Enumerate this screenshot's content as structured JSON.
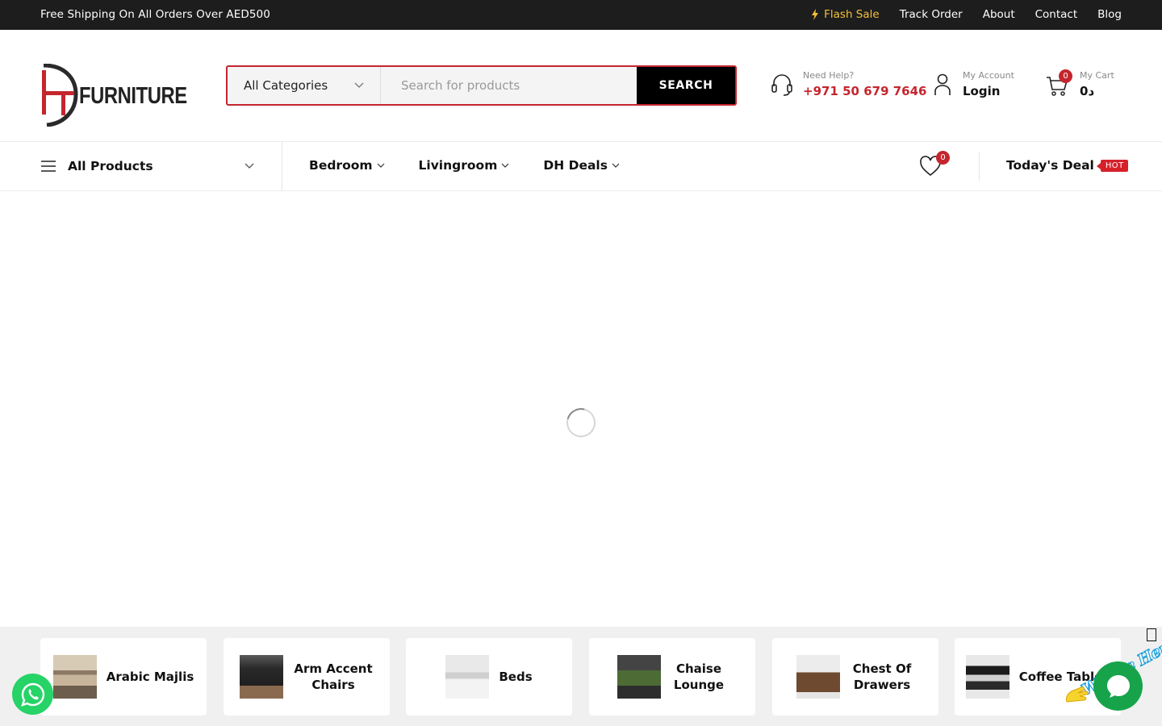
{
  "topbar": {
    "shipping": "Free Shipping On All Orders Over AED500",
    "links": [
      "Flash Sale",
      "Track Order",
      "About",
      "Contact",
      "Blog"
    ]
  },
  "logo": {
    "text": "FURNITURE"
  },
  "search": {
    "category": "All Categories",
    "placeholder": "Search for products",
    "button": "SEARCH"
  },
  "help": {
    "label": "Need Help?",
    "phone": "+971 50 679 7646"
  },
  "account": {
    "label": "My Account",
    "action": "Login"
  },
  "cart": {
    "label": "My Cart",
    "total": "0د",
    "count": "0"
  },
  "nav": {
    "all_products": "All Products",
    "items": [
      "Bedroom",
      "Livingroom",
      "DH Deals"
    ],
    "wishlist_count": "0",
    "deal": "Today's Deal",
    "deal_badge": "HOT"
  },
  "categories": [
    {
      "name": "Arabic Majlis"
    },
    {
      "name": "Arm Accent Chairs"
    },
    {
      "name": "Beds"
    },
    {
      "name": "Chaise Lounge"
    },
    {
      "name": "Chest Of Drawers"
    },
    {
      "name": "Coffee Tables"
    }
  ],
  "chat": {
    "banner": "We Are Here!"
  },
  "colors": {
    "brand_red": "#c4262e",
    "flash_yellow": "#f3c13a",
    "whatsapp_green": "#25d366",
    "chat_green": "#17a34a"
  }
}
